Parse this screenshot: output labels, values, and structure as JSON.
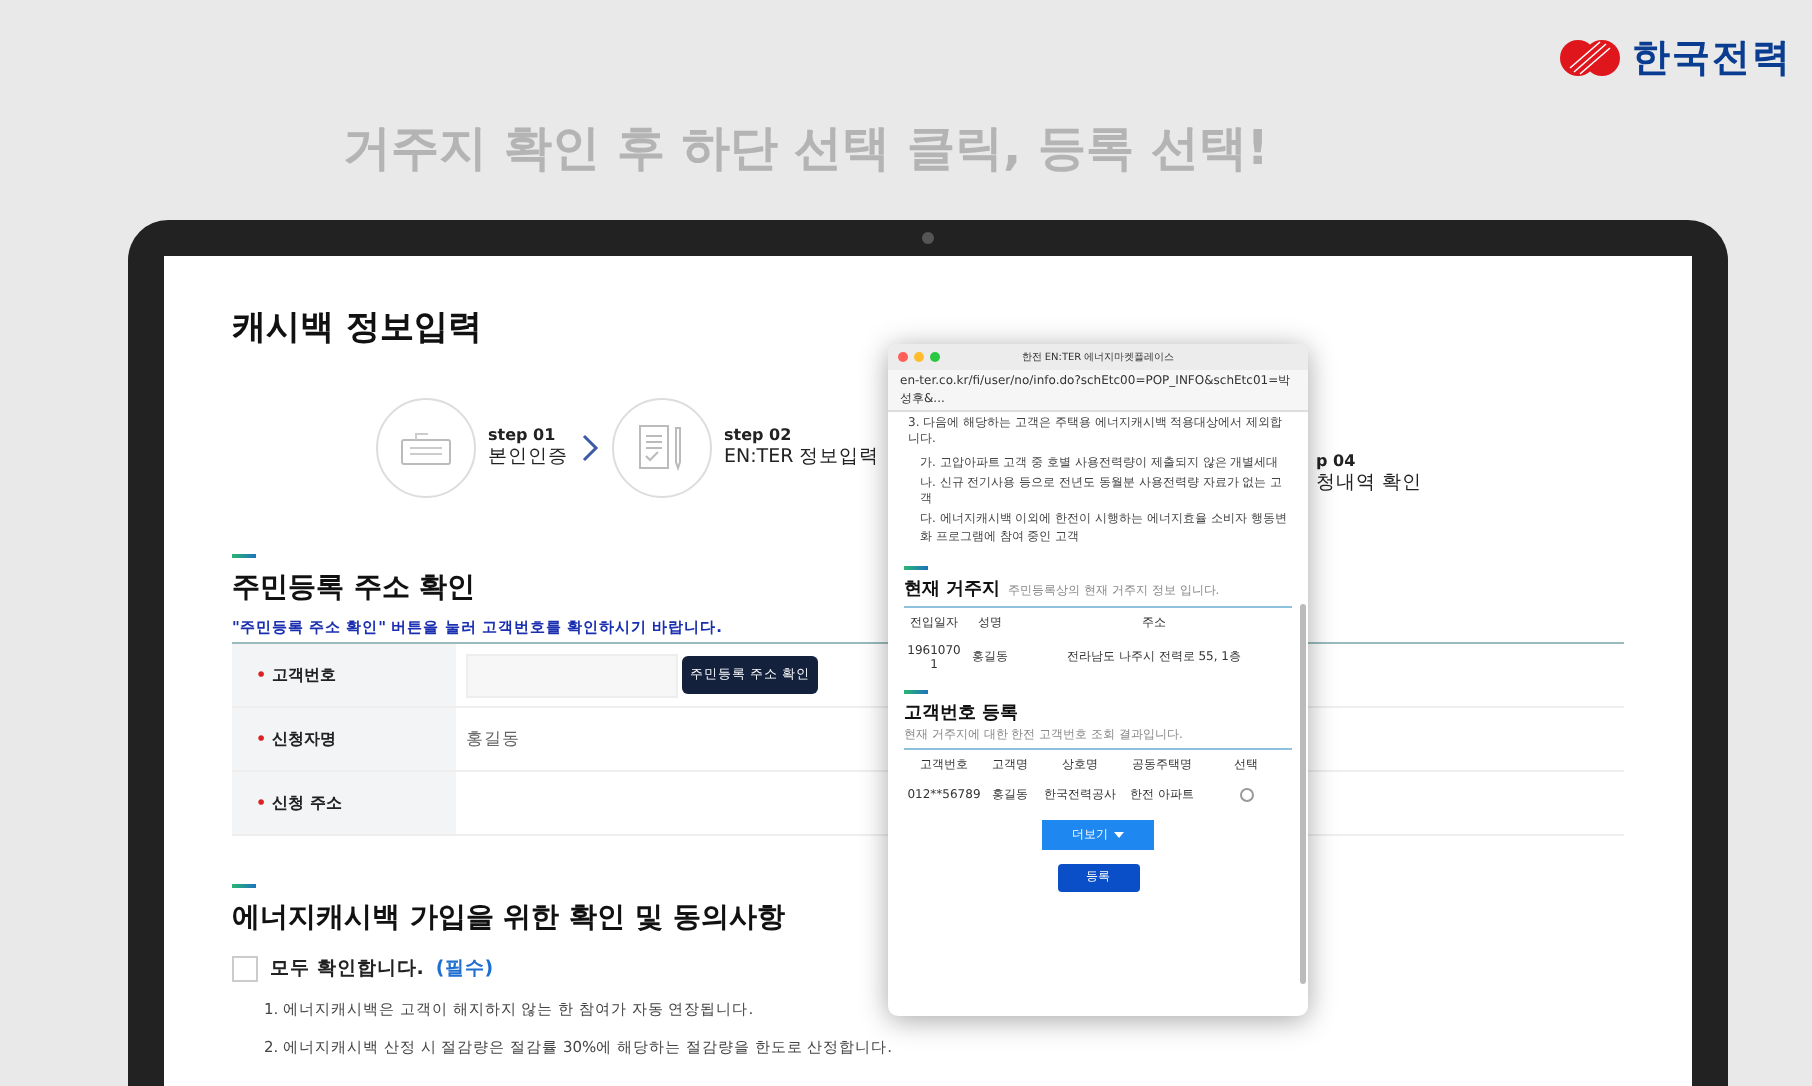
{
  "logo": {
    "text": "한국전력"
  },
  "caption": "거주지 확인 후 하단 선택 클릭, 등록 선택!",
  "page": {
    "title": "캐시백 정보입력",
    "steps": [
      {
        "step": "step 01",
        "label": "본인인증"
      },
      {
        "step": "step 02",
        "label": "EN:TER 정보입력"
      }
    ],
    "step_partial": {
      "step": "p 04",
      "label": "청내역 확인"
    },
    "address_section": {
      "title": "주민등록 주소 확인",
      "notice": "\"주민등록 주소 확인\" 버튼을 눌러 고객번호를 확인하시기 바랍니다.",
      "rows": [
        {
          "mark": "•",
          "label": "고객번호",
          "kind": "input",
          "button": "주민등록 주소 확인"
        },
        {
          "mark": "•",
          "label": "신청자명",
          "kind": "text",
          "value": "홍길동"
        },
        {
          "mark": "•",
          "label": "신청 주소",
          "kind": "empty"
        }
      ]
    },
    "consent_section": {
      "title": "에너지캐시백 가입을 위한 확인 및 동의사항",
      "agree_all": {
        "label": "모두 확인합니다.",
        "required": "(필수)",
        "checked": false
      },
      "items": [
        "1. 에너지캐시백은 고객이 해지하지 않는 한 참여가 자동 연장됩니다.",
        "2. 에너지캐시백 산정 시 절감량은 절감률 30%에 해당하는 절감량을 한도로 산정합니다."
      ]
    }
  },
  "popup": {
    "title": "한전 EN:TER 에너지마켓플레이스",
    "url": "en-ter.co.kr/fi/user/no/info.do?schEtc00=POP_INFO&schEtc01=박성후&...",
    "intro": "3. 다음에 해당하는 고객은 주택용 에너지캐시백 적용대상에서 제외합니다.",
    "items": [
      "가. 고압아파트 고객 중 호별 사용전력량이 제출되지 않은 개별세대",
      "나. 신규 전기사용 등으로 전년도 동월분 사용전력량 자료가 없는 고객",
      "다. 에너지캐시백 이외에 한전이 시행하는 에너지효율 소비자 행동변화 프로그램에 참여 중인 고객"
    ],
    "residence": {
      "title": "현재 거주지",
      "subtitle": "주민등록상의 현재 거주지 정보 입니다.",
      "columns": [
        "전입일자",
        "성명",
        "주소"
      ],
      "rows": [
        [
          "19610701",
          "홍길동",
          "전라남도 나주시 전력로 55, 1층"
        ]
      ]
    },
    "customer": {
      "title": "고객번호 등록",
      "subtitle": "현재 거주지에 대한 한전 고객번호 조회 결과입니다.",
      "columns": [
        "고객번호",
        "고객명",
        "상호명",
        "공동주택명",
        "선택"
      ],
      "rows": [
        {
          "cells": [
            "012**56789",
            "홍길동",
            "한국전력공사",
            "한전 아파트"
          ],
          "selected": false
        }
      ]
    },
    "more_button": "더보기",
    "register_button": "등록"
  }
}
